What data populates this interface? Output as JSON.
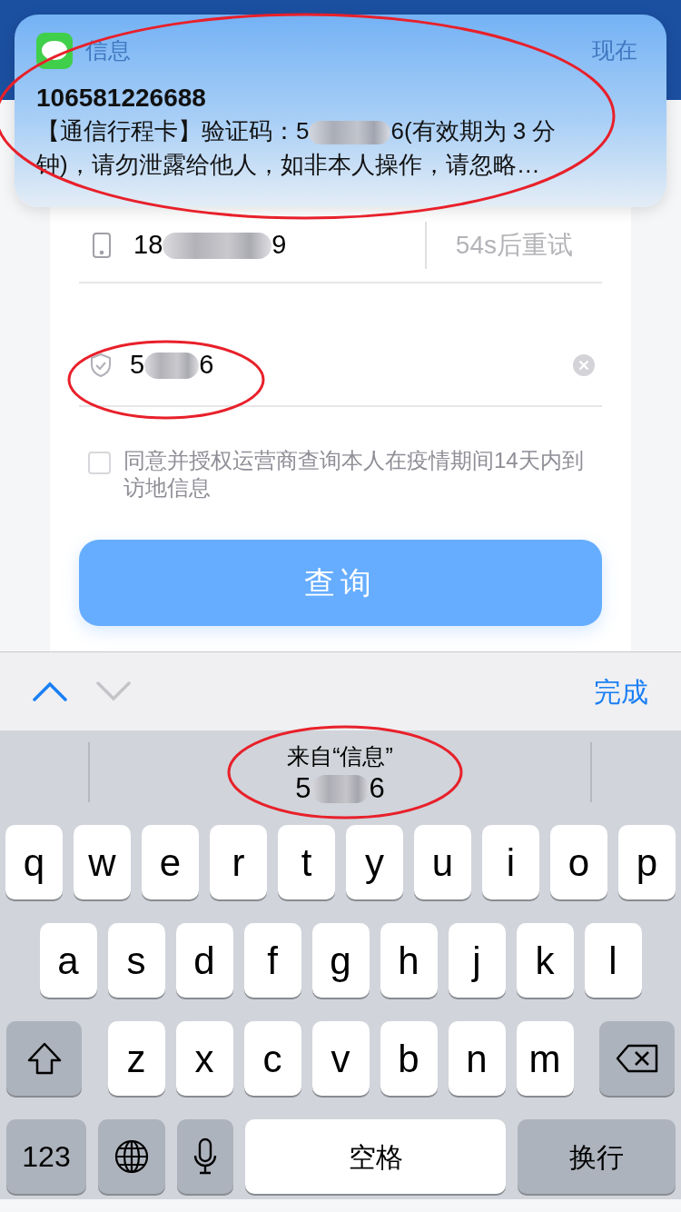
{
  "notification": {
    "app": "信息",
    "time": "现在",
    "sender": "106581226688",
    "body_start": "【通信行程卡】验证码：5",
    "body_end": "6(有效期为 3 分钟)，请勿泄露给他人，如非本人操作，请忽略…"
  },
  "form": {
    "phone": {
      "start": "18",
      "end": "9"
    },
    "resend": "54s后重试",
    "code": {
      "start": "5",
      "end": "6"
    },
    "consent": {
      "checked": false,
      "text": "同意并授权运营商查询本人在疫情期间14天内到访地信息"
    },
    "submit": "查询"
  },
  "toolbar": {
    "prev": {
      "disabled": false
    },
    "next": {
      "disabled": true
    },
    "done": "完成"
  },
  "suggestion": {
    "label": "来自“信息”",
    "start": "5",
    "end": "6"
  },
  "keyboard": {
    "rows": [
      {
        "keys": [
          {
            "kind": "char",
            "label": "q"
          },
          {
            "kind": "char",
            "label": "w"
          },
          {
            "kind": "char",
            "label": "e"
          },
          {
            "kind": "char",
            "label": "r"
          },
          {
            "kind": "char",
            "label": "t"
          },
          {
            "kind": "char",
            "label": "y"
          },
          {
            "kind": "char",
            "label": "u"
          },
          {
            "kind": "char",
            "label": "i"
          },
          {
            "kind": "char",
            "label": "o"
          },
          {
            "kind": "char",
            "label": "p"
          }
        ]
      },
      {
        "keys": [
          {
            "kind": "char",
            "label": "a"
          },
          {
            "kind": "char",
            "label": "s"
          },
          {
            "kind": "char",
            "label": "d"
          },
          {
            "kind": "char",
            "label": "f"
          },
          {
            "kind": "char",
            "label": "g"
          },
          {
            "kind": "char",
            "label": "h"
          },
          {
            "kind": "char",
            "label": "j"
          },
          {
            "kind": "char",
            "label": "k"
          },
          {
            "kind": "char",
            "label": "l"
          }
        ]
      },
      {
        "keys": [
          {
            "kind": "shift"
          },
          {
            "kind": "char",
            "label": "z"
          },
          {
            "kind": "char",
            "label": "x"
          },
          {
            "kind": "char",
            "label": "c"
          },
          {
            "kind": "char",
            "label": "v"
          },
          {
            "kind": "char",
            "label": "b"
          },
          {
            "kind": "char",
            "label": "n"
          },
          {
            "kind": "char",
            "label": "m"
          },
          {
            "kind": "delete"
          }
        ]
      },
      {
        "keys": [
          {
            "kind": "numbers",
            "label": "123"
          },
          {
            "kind": "globe"
          },
          {
            "kind": "mic"
          },
          {
            "kind": "space",
            "label": "空格"
          },
          {
            "kind": "return",
            "label": "换行"
          }
        ]
      }
    ]
  }
}
